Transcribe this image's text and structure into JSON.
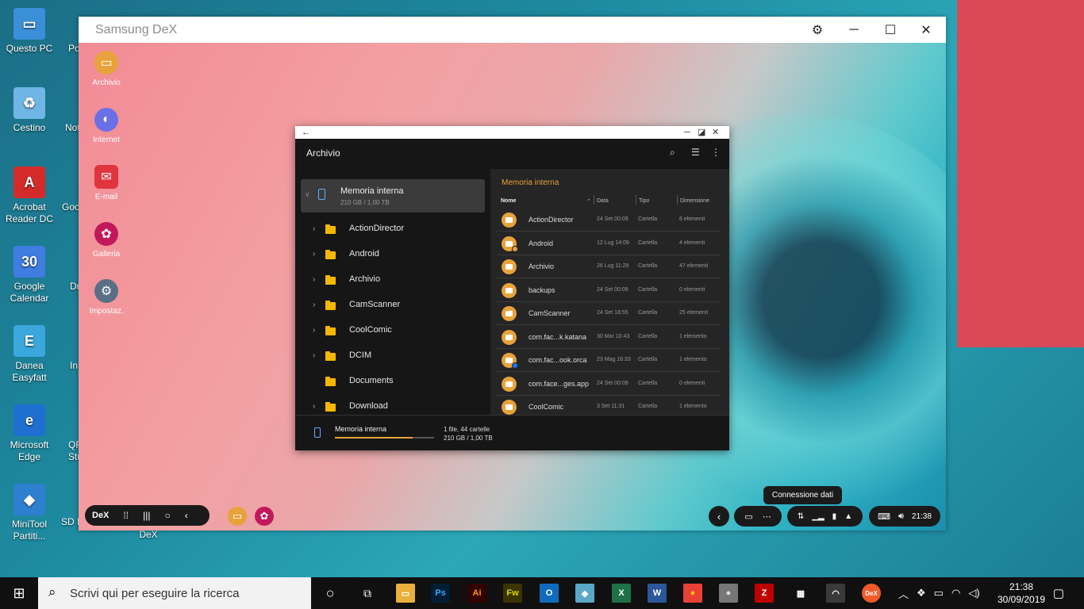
{
  "desktop": {
    "icons": [
      {
        "label": "Questo PC",
        "color": "#3a8fd8"
      },
      {
        "label": "Cestino",
        "color": "#6fb6e6"
      },
      {
        "label": "Acrobat Reader DC",
        "color": "#d42a2a"
      },
      {
        "label": "Google Calendar",
        "color": "#3f7de0"
      },
      {
        "label": "Danea Easyfatt",
        "color": "#3aa7dd"
      },
      {
        "label": "Microsoft Edge",
        "color": "#1f6fd1"
      },
      {
        "label": "MiniTool Partiti...",
        "color": "#2f7fd0"
      },
      {
        "label": "SD Formatter",
        "color": "#2a6fc8"
      },
      {
        "label": "DeX",
        "color": "#1f1f1f"
      }
    ],
    "partial_labels": [
      "Po",
      "Not",
      "Goo",
      "Dr",
      "In",
      "QR Stu"
    ]
  },
  "dex_window": {
    "title": "Samsung DeX",
    "apps": [
      {
        "label": "Archivio",
        "color": "#e8a23b",
        "glyph": "▭"
      },
      {
        "label": "Internet",
        "color": "#6b6fe6",
        "glyph": "◐"
      },
      {
        "label": "E-mail",
        "color": "#e0343e",
        "glyph": "✉"
      },
      {
        "label": "Galleria",
        "color": "#c2185b",
        "glyph": "✿"
      },
      {
        "label": "Impostaz.",
        "color": "#5a6f85",
        "glyph": "⚙"
      }
    ]
  },
  "file_manager": {
    "title": "Archivio",
    "back": "←",
    "storage": {
      "name": "Memoria interna",
      "size": "210 GB / 1,00 TB"
    },
    "tree": [
      "ActionDirector",
      "Android",
      "Archivio",
      "CamScanner",
      "CoolComic",
      "DCIM",
      "Documents",
      "Download"
    ],
    "path": "Memoria interna",
    "columns": {
      "name": "Nome",
      "date": "Data",
      "type": "Tipo",
      "size": "Dimensione"
    },
    "files": [
      {
        "name": "ActionDirector",
        "date": "24 Set 00:09",
        "type": "Cartella",
        "size": "6 elementi",
        "badge": ""
      },
      {
        "name": "Android",
        "date": "12 Lug 14:09",
        "type": "Cartella",
        "size": "4 elementi",
        "badge": "gear"
      },
      {
        "name": "Archivio",
        "date": "26 Lug 11:29",
        "type": "Cartella",
        "size": "47 elementi",
        "badge": ""
      },
      {
        "name": "backups",
        "date": "24 Set 00:09",
        "type": "Cartella",
        "size": "0 elementi",
        "badge": ""
      },
      {
        "name": "CamScanner",
        "date": "24 Set 18:55",
        "type": "Cartella",
        "size": "25 elementi",
        "badge": ""
      },
      {
        "name": "com.fac...k.katana",
        "date": "30 Mar 10:43",
        "type": "Cartella",
        "size": "1 elemento",
        "badge": ""
      },
      {
        "name": "com.fac...ook.orca",
        "date": "23 Mag 16:33",
        "type": "Cartella",
        "size": "1 elemento",
        "badge": "fb"
      },
      {
        "name": "com.face...ges.app",
        "date": "24 Set 00:09",
        "type": "Cartella",
        "size": "0 elementi",
        "badge": ""
      },
      {
        "name": "CoolComic",
        "date": "3 Set 11:31",
        "type": "Cartella",
        "size": "1 elemento",
        "badge": ""
      }
    ],
    "footer": {
      "name": "Memoria interna",
      "line1": "1 file, 44 cartelle",
      "line2": "210 GB / 1,00 TB",
      "used_fraction": 0.21
    }
  },
  "dex_taskbar": {
    "dex_label": "DeX",
    "tooltip": "Connessione dati",
    "time": "21:38"
  },
  "windows_taskbar": {
    "search_placeholder": "Scrivi qui per eseguire la ricerca",
    "apps": [
      {
        "label": "Ps",
        "color": "#001d34",
        "fg": "#31a8ff"
      },
      {
        "label": "Ai",
        "color": "#330000",
        "fg": "#ff9a00"
      },
      {
        "label": "Fw",
        "color": "#3b3300",
        "fg": "#d8d800"
      },
      {
        "label": "O",
        "color": "#0f6cbd",
        "fg": "#ffffff"
      },
      {
        "label": "◆",
        "color": "#5aa8c7",
        "fg": "#ffffff"
      },
      {
        "label": "X",
        "color": "#1e7145",
        "fg": "#ffffff"
      },
      {
        "label": "W",
        "color": "#2b579a",
        "fg": "#ffffff"
      },
      {
        "label": "●",
        "color": "#e94235",
        "fg": "#fbbc04"
      },
      {
        "label": "●",
        "color": "#777777",
        "fg": "#dddddd"
      },
      {
        "label": "Z",
        "color": "#bf0000",
        "fg": "#ffffff"
      },
      {
        "label": "▦",
        "color": "#101010",
        "fg": "#ffffff"
      },
      {
        "label": "◠",
        "color": "#3a3a3a",
        "fg": "#ffffff"
      },
      {
        "label": "DeX",
        "color": "#f05a28",
        "fg": "#ffffff"
      }
    ],
    "clock_time": "21:38",
    "clock_date": "30/09/2019"
  }
}
